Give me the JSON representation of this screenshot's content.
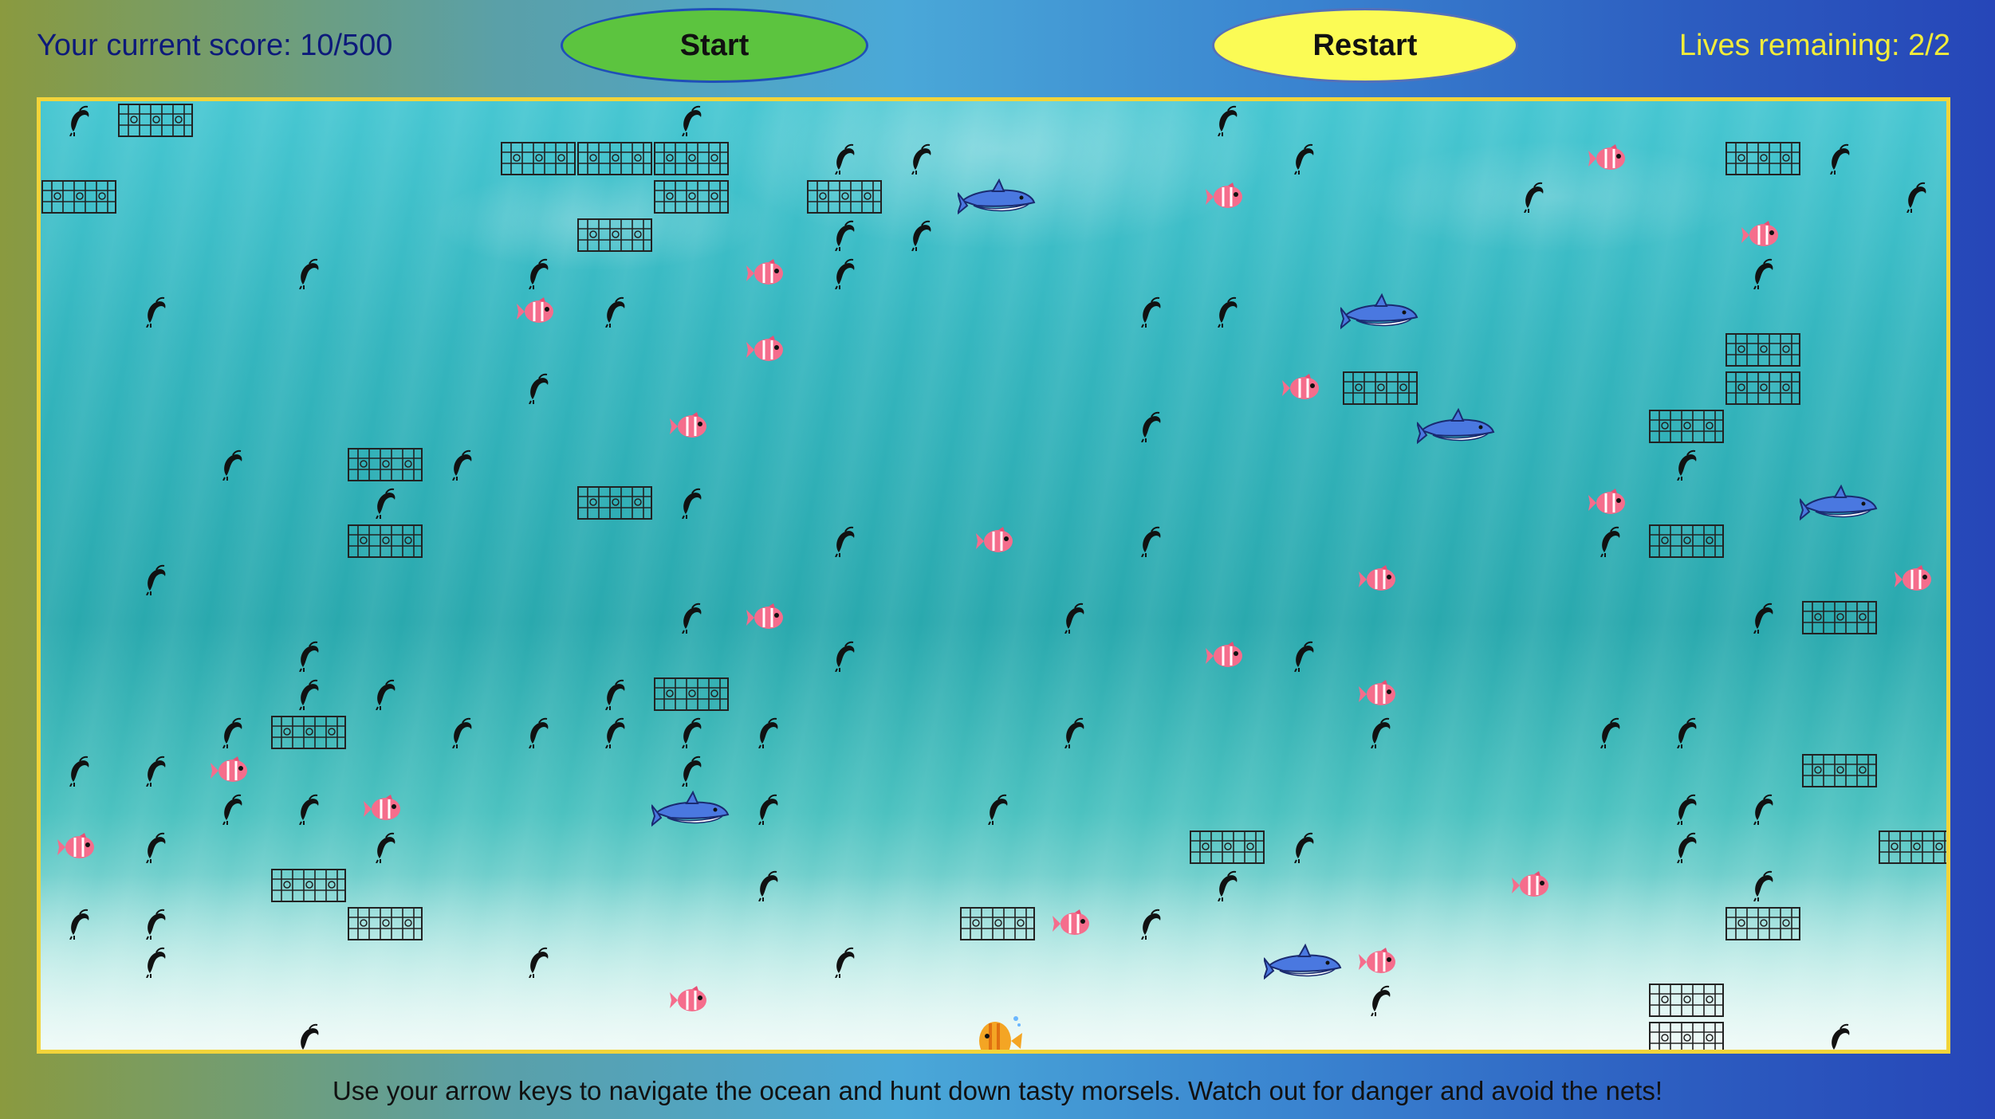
{
  "header": {
    "score_text": "Your current score: 10/500",
    "start_label": "Start",
    "restart_label": "Restart",
    "lives_text": "Lives remaining: 2/2"
  },
  "game": {
    "columns": 25,
    "rows": 25,
    "cell_units": "grid cells (col,row), 0-indexed",
    "player_icon": "yellow-fish-icon",
    "player": [
      12,
      24
    ],
    "food": [
      [
        0,
        0
      ],
      [
        8,
        0
      ],
      [
        15,
        0
      ],
      [
        10,
        1
      ],
      [
        11,
        1
      ],
      [
        16,
        1
      ],
      [
        23,
        1
      ],
      [
        19,
        2
      ],
      [
        24,
        2
      ],
      [
        10,
        3
      ],
      [
        11,
        3
      ],
      [
        3,
        4
      ],
      [
        6,
        4
      ],
      [
        10,
        4
      ],
      [
        1,
        5
      ],
      [
        7,
        5
      ],
      [
        14,
        5
      ],
      [
        15,
        5
      ],
      [
        22,
        4
      ],
      [
        6,
        7
      ],
      [
        14,
        8
      ],
      [
        2,
        9
      ],
      [
        5,
        9
      ],
      [
        21,
        9
      ],
      [
        4,
        10
      ],
      [
        8,
        10
      ],
      [
        10,
        11
      ],
      [
        14,
        11
      ],
      [
        20,
        11
      ],
      [
        1,
        12
      ],
      [
        8,
        13
      ],
      [
        13,
        13
      ],
      [
        22,
        13
      ],
      [
        3,
        14
      ],
      [
        10,
        14
      ],
      [
        16,
        14
      ],
      [
        3,
        15
      ],
      [
        4,
        15
      ],
      [
        7,
        15
      ],
      [
        2,
        16
      ],
      [
        5,
        16
      ],
      [
        6,
        16
      ],
      [
        7,
        16
      ],
      [
        8,
        16
      ],
      [
        9,
        16
      ],
      [
        13,
        16
      ],
      [
        17,
        16
      ],
      [
        20,
        16
      ],
      [
        21,
        16
      ],
      [
        0,
        17
      ],
      [
        1,
        17
      ],
      [
        8,
        17
      ],
      [
        2,
        18
      ],
      [
        3,
        18
      ],
      [
        9,
        18
      ],
      [
        12,
        18
      ],
      [
        21,
        18
      ],
      [
        22,
        18
      ],
      [
        1,
        19
      ],
      [
        4,
        19
      ],
      [
        16,
        19
      ],
      [
        21,
        19
      ],
      [
        9,
        20
      ],
      [
        15,
        20
      ],
      [
        22,
        20
      ],
      [
        0,
        21
      ],
      [
        1,
        21
      ],
      [
        14,
        21
      ],
      [
        1,
        22
      ],
      [
        6,
        22
      ],
      [
        10,
        22
      ],
      [
        17,
        23
      ],
      [
        3,
        24
      ],
      [
        23,
        24
      ]
    ],
    "nets": [
      [
        1,
        0
      ],
      [
        6,
        1
      ],
      [
        7,
        1
      ],
      [
        8,
        1
      ],
      [
        22,
        1
      ],
      [
        0,
        2
      ],
      [
        8,
        2
      ],
      [
        10,
        2
      ],
      [
        7,
        3
      ],
      [
        22,
        6
      ],
      [
        17,
        7
      ],
      [
        22,
        7
      ],
      [
        21,
        8
      ],
      [
        4,
        9
      ],
      [
        7,
        10
      ],
      [
        4,
        11
      ],
      [
        21,
        11
      ],
      [
        23,
        13
      ],
      [
        8,
        15
      ],
      [
        3,
        16
      ],
      [
        23,
        17
      ],
      [
        15,
        19
      ],
      [
        24,
        19
      ],
      [
        3,
        20
      ],
      [
        4,
        21
      ],
      [
        12,
        21
      ],
      [
        22,
        21
      ],
      [
        21,
        23
      ],
      [
        21,
        24
      ]
    ],
    "fish": [
      [
        15,
        2
      ],
      [
        20,
        1
      ],
      [
        22,
        3
      ],
      [
        9,
        4
      ],
      [
        6,
        5
      ],
      [
        9,
        6
      ],
      [
        16,
        7
      ],
      [
        8,
        8
      ],
      [
        20,
        10
      ],
      [
        12,
        11
      ],
      [
        17,
        12
      ],
      [
        24,
        12
      ],
      [
        9,
        13
      ],
      [
        15,
        14
      ],
      [
        17,
        15
      ],
      [
        2,
        17
      ],
      [
        4,
        18
      ],
      [
        0,
        19
      ],
      [
        19,
        20
      ],
      [
        13,
        21
      ],
      [
        17,
        22
      ],
      [
        8,
        23
      ]
    ],
    "sharks": [
      [
        12,
        2
      ],
      [
        17,
        5
      ],
      [
        18,
        8
      ],
      [
        23,
        10
      ],
      [
        8,
        18
      ],
      [
        16,
        22
      ]
    ]
  },
  "footer": {
    "instructions": "Use your arrow keys to navigate the ocean and hunt down tasty morsels. Watch out for danger and avoid the nets!"
  },
  "colors": {
    "border": "#f2d43a",
    "start_button": "#5cc43f",
    "restart_button": "#fbfb55",
    "score_text": "#0d1a7a",
    "lives_text": "#f2ec3a"
  }
}
